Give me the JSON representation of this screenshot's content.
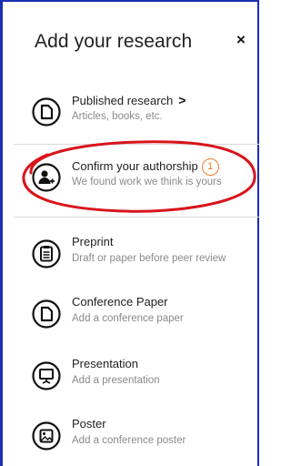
{
  "panel": {
    "title": "Add your research",
    "close_symbol": "×"
  },
  "items": [
    {
      "label": "Published research",
      "sub": "Articles, books, etc.",
      "icon": "document-icon",
      "chevron": ">"
    },
    {
      "label": "Confirm your authorship",
      "sub": "We found work we think is yours",
      "icon": "add-person-icon",
      "badge": "1"
    },
    {
      "label": "Preprint",
      "sub": "Draft or paper before peer review",
      "icon": "clipboard-icon"
    },
    {
      "label": "Conference Paper",
      "sub": "Add a conference paper",
      "icon": "document-icon"
    },
    {
      "label": "Presentation",
      "sub": "Add a presentation",
      "icon": "presentation-icon"
    },
    {
      "label": "Poster",
      "sub": "Add a conference poster",
      "icon": "poster-icon"
    }
  ],
  "colors": {
    "frame": "#1a2fb0",
    "highlight": "#d9141c",
    "badge": "#f07a2a"
  }
}
